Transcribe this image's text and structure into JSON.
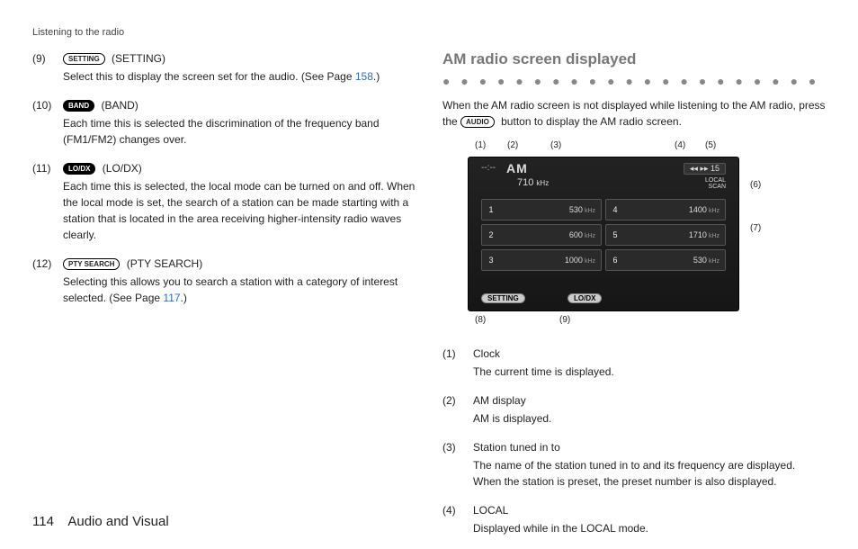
{
  "header": "Listening to the radio",
  "left_items": [
    {
      "num": "(9)",
      "pill": "SETTING",
      "label": "(SETTING)",
      "desc_pre": "Select this to display the screen set for the audio. (See Page ",
      "page_ref": "158",
      "desc_post": ".)"
    },
    {
      "num": "(10)",
      "pill": "BAND",
      "pill_inv": true,
      "label": "(BAND)",
      "desc": "Each time this is selected the discrimination of the frequency band (FM1/FM2) changes over."
    },
    {
      "num": "(11)",
      "pill": "LO/DX",
      "pill_inv": true,
      "label": "(LO/DX)",
      "desc": "Each time this is selected, the local mode can be turned on and off. When the local mode is set, the search of a station can be made starting with a station that is located in the area receiving higher-intensity radio waves clearly."
    },
    {
      "num": "(12)",
      "pill": "PTY SEARCH",
      "label": "(PTY SEARCH)",
      "desc_pre": "Selecting this allows you to search a station with a category of interest selected. (See Page ",
      "page_ref": "117",
      "desc_post": ".)"
    }
  ],
  "section_title": "AM radio screen displayed",
  "intro": {
    "pre": "When the AM radio screen is not displayed while listening to the AM radio, press the ",
    "pill": "AUDIO",
    "post": " button to display the AM radio screen."
  },
  "fig": {
    "clock": "--:--",
    "band": "AM",
    "freq": "710",
    "freq_unit": "kHz",
    "seek": "◂◂ ▸▸ 15",
    "local": "LOCAL",
    "scan": "SCAN",
    "presets": [
      {
        "n": "1",
        "f": "530",
        "u": "kHz"
      },
      {
        "n": "4",
        "f": "1400",
        "u": "kHz"
      },
      {
        "n": "2",
        "f": "600",
        "u": "kHz"
      },
      {
        "n": "5",
        "f": "1710",
        "u": "kHz"
      },
      {
        "n": "3",
        "f": "1000",
        "u": "kHz"
      },
      {
        "n": "6",
        "f": "530",
        "u": "kHz"
      }
    ],
    "setting": "SETTING",
    "lodx": "LO/DX"
  },
  "callouts": {
    "1": "(1)",
    "2": "(2)",
    "3": "(3)",
    "4": "(4)",
    "5": "(5)",
    "6": "(6)",
    "7": "(7)",
    "8": "(8)",
    "9": "(9)"
  },
  "right_items": [
    {
      "num": "(1)",
      "label": "Clock",
      "desc": "The current time is displayed."
    },
    {
      "num": "(2)",
      "label": "AM display",
      "desc": "AM is displayed."
    },
    {
      "num": "(3)",
      "label": "Station tuned in to",
      "desc": "The name of the station tuned in to and its frequency are displayed. When the station is preset, the preset number is also displayed."
    },
    {
      "num": "(4)",
      "label": "LOCAL",
      "desc": "Displayed while in the LOCAL mode."
    }
  ],
  "footer": {
    "page": "114",
    "section": "Audio and Visual"
  }
}
